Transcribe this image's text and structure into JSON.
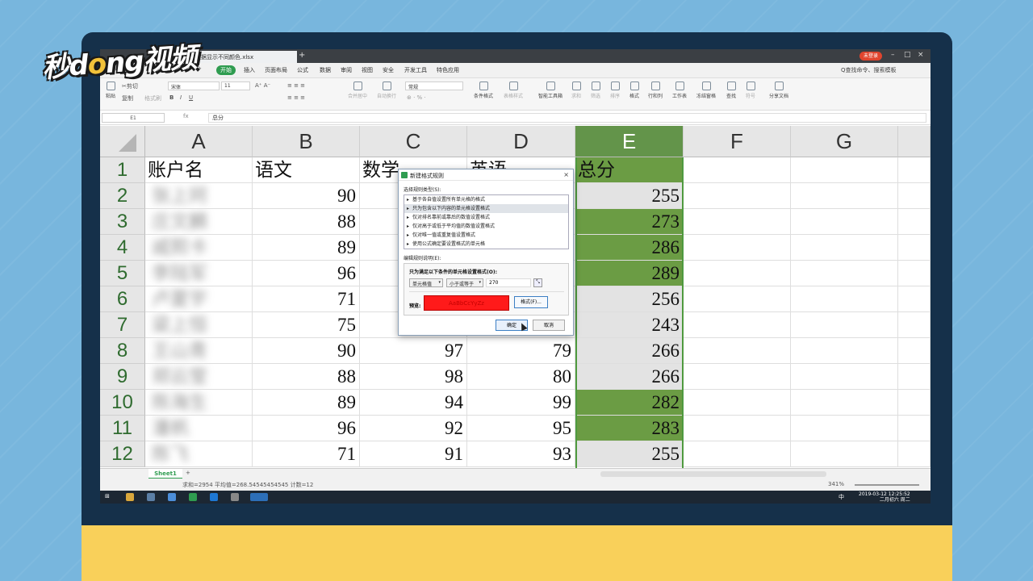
{
  "brand": {
    "logo_a": "秒d",
    "logo_dot": "o",
    "logo_b": "ng视频"
  },
  "window": {
    "tab_title": "数据显示不同颜色.xlsx",
    "user_badge": "未登录"
  },
  "menu": {
    "start": "开始",
    "items": [
      "插入",
      "页面布局",
      "公式",
      "数据",
      "审阅",
      "视图",
      "安全",
      "开发工具",
      "特色应用"
    ],
    "search": "Q查找命令、搜索模板"
  },
  "toolbar": {
    "paste": "粘贴",
    "cut": "✂剪切",
    "copy": "复制",
    "format_painter": "格式刷",
    "font_name": "宋体",
    "font_size": "11",
    "merge": "合并居中",
    "wrap": "自动换行",
    "number_format": "常规",
    "cond_format": "条件格式",
    "table_style": "表格样式",
    "smart_toolbox": "智能工具箱",
    "sum": "求和",
    "filter": "筛选",
    "sort": "排序",
    "format": "格式",
    "rowcol": "行和列",
    "worksheet": "工作表",
    "freeze": "冻结窗格",
    "find": "查找",
    "symbol": "符号",
    "share": "分享文档"
  },
  "formula_bar": {
    "name_box": "E1",
    "fx": "fx",
    "content": "总分"
  },
  "columns": [
    "A",
    "B",
    "C",
    "D",
    "E",
    "F",
    "G"
  ],
  "rows": [
    "1",
    "2",
    "3",
    "4",
    "5",
    "6",
    "7",
    "8",
    "9",
    "10",
    "11",
    "12"
  ],
  "header_row": [
    "账户名",
    "语文",
    "数学",
    "英语",
    "总分"
  ],
  "data": [
    {
      "name": "张上珂",
      "b": "90",
      "c": "",
      "d": "",
      "e": "255",
      "hi": false
    },
    {
      "name": "庄文麟",
      "b": "88",
      "c": "",
      "d": "",
      "e": "273",
      "hi": true
    },
    {
      "name": "戚熙卡",
      "b": "89",
      "c": "",
      "d": "",
      "e": "286",
      "hi": true
    },
    {
      "name": "李陆军",
      "b": "96",
      "c": "",
      "d": "",
      "e": "289",
      "hi": true
    },
    {
      "name": "卢夏宇",
      "b": "71",
      "c": "",
      "d": "",
      "e": "256",
      "hi": false
    },
    {
      "name": "梁上恒",
      "b": "75",
      "c": "",
      "d": "",
      "e": "243",
      "hi": false
    },
    {
      "name": "王山青",
      "b": "90",
      "c": "97",
      "d": "79",
      "e": "266",
      "hi": false
    },
    {
      "name": "郑云莹",
      "b": "88",
      "c": "98",
      "d": "80",
      "e": "266",
      "hi": false
    },
    {
      "name": "陈海生",
      "b": "89",
      "c": "94",
      "d": "99",
      "e": "282",
      "hi": true
    },
    {
      "name": "潘帆",
      "b": "96",
      "c": "92",
      "d": "95",
      "e": "283",
      "hi": true
    },
    {
      "name": "陈飞",
      "b": "71",
      "c": "91",
      "d": "93",
      "e": "255",
      "hi": false
    }
  ],
  "sheet": {
    "tab": "Sheet1",
    "add": "+"
  },
  "status": {
    "summary": "求和=2954   平均值=268.54545454545   计数=12",
    "zoom": "341%"
  },
  "taskbar": {
    "time": "2019-03-12  12:25:52",
    "date2": "二月初六 周二",
    "ime": "中"
  },
  "dialog": {
    "title": "新建格式规则",
    "close": "×",
    "select_label": "选择规则类型(S):",
    "rules": [
      "基于各自值设置所有单元格的格式",
      "只为包含以下内容的单元格设置格式",
      "仅对排名靠前或靠后的数值设置格式",
      "仅对高于或低于平均值的数值设置格式",
      "仅对唯一值或重复值设置格式",
      "使用公式确定要设置格式的单元格"
    ],
    "edit_label": "编辑规则说明(E):",
    "desc_title": "只为满足以下条件的单元格设置格式(O):",
    "cond_type": "单元格值",
    "operator": "小于或等于",
    "value": "270",
    "preview_label": "预览:",
    "preview_text": "AaBbCcYyZz",
    "format_button": "格式(F)...",
    "ok": "确定",
    "cancel": "取消"
  },
  "colors": {
    "highlight": "#6b9c44",
    "accent": "#2f9c50",
    "preview_fill": "#ff1a1a"
  }
}
